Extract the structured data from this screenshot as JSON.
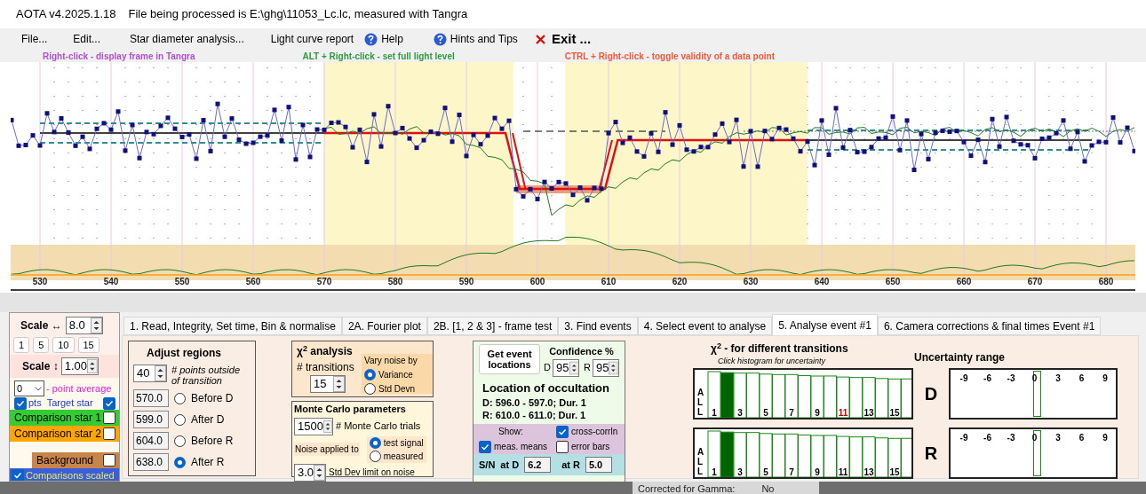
{
  "window": {
    "title": "AOTA v4.2025.1.18",
    "subtitle": "File being processed is E:\\ghg\\11053_Lc.lc, measured with Tangra"
  },
  "menu": [
    {
      "label": "File...",
      "kind": "plain"
    },
    {
      "label": "Edit...",
      "kind": "plain"
    },
    {
      "label": "Star diameter analysis...",
      "kind": "plain"
    },
    {
      "label": "Light curve report",
      "kind": "plain"
    },
    {
      "label": "Help",
      "kind": "help"
    },
    {
      "label": "Hints and Tips",
      "kind": "help"
    },
    {
      "label": "Exit ...",
      "kind": "exit"
    }
  ],
  "hints": [
    {
      "text": "Right-click  -  display frame in Tangra",
      "color": "#b04fd0"
    },
    {
      "text": "ALT + Right-click  -  set full light level",
      "color": "#2e9a3e"
    },
    {
      "text": "CTRL + Right-click  -  toggle validity of a data point",
      "color": "#f05a3c"
    }
  ],
  "light_curve": {
    "x_labels": [
      "530",
      "540",
      "550",
      "560",
      "570",
      "580",
      "590",
      "600",
      "610",
      "620",
      "630",
      "640",
      "650",
      "660",
      "670",
      "680"
    ]
  },
  "scale_panel": {
    "horizontal": {
      "label": "Scale ↔",
      "value": "8.0"
    },
    "presets": [
      "1",
      "5",
      "10",
      "15"
    ],
    "vertical": {
      "label": "Scale ↕",
      "value": "1.00"
    }
  },
  "display_panel": {
    "average": {
      "value": "0",
      "label": "- point average"
    },
    "plot_points": {
      "label": "pts",
      "checked": true
    },
    "series": [
      {
        "label": "Target star",
        "checked": true,
        "color": "#fff8ec"
      },
      {
        "label": "Comparison star 1",
        "checked": false,
        "color": "#33cc33"
      },
      {
        "label": "Comparison star 2",
        "checked": false,
        "color": "#ffa500"
      },
      {
        "label": "Background",
        "checked": false,
        "color": "#c8854a"
      }
    ],
    "scaled": {
      "label": "Comparisons scaled",
      "checked": true
    }
  },
  "tabs": [
    {
      "label": "1.  Read, Integrity, Set time, Bin & normalise",
      "selected": false
    },
    {
      "label": "2A. Fourier plot",
      "selected": false
    },
    {
      "label": "2B. [1, 2 & 3] - frame test",
      "selected": false
    },
    {
      "label": "3. Find events",
      "selected": false
    },
    {
      "label": "4. Select event to analyse",
      "selected": false
    },
    {
      "label": "5. Analyse event #1",
      "selected": true
    },
    {
      "label": "6. Camera corrections & final times Event #1",
      "selected": false
    }
  ],
  "adjust_regions": {
    "title": "Adjust regions",
    "points": {
      "value": "40",
      "label": "# points outside of transition"
    },
    "regions": [
      {
        "value": "570.0",
        "label": "Before D",
        "selected": false
      },
      {
        "value": "599.0",
        "label": "After D",
        "selected": false
      },
      {
        "value": "604.0",
        "label": "Before R",
        "selected": false
      },
      {
        "value": "638.0",
        "label": "After R",
        "selected": true
      }
    ]
  },
  "chi2_analysis": {
    "title": "χ$^{2}$ analysis",
    "transitions_label": "# transitions",
    "transitions": "15",
    "vary_title": "Vary noise by",
    "vary_options": [
      {
        "label": "Variance",
        "selected": true
      },
      {
        "label": "Std Devn",
        "selected": false
      }
    ]
  },
  "monte_carlo": {
    "title": "Monte Carlo parameters",
    "trials": {
      "value": "1500",
      "label": "# Monte Carlo trials"
    },
    "noise_label": "Noise applied to",
    "noise_options": [
      {
        "label": "test signal",
        "selected": true
      },
      {
        "label": "measured",
        "selected": false
      }
    ],
    "limit": {
      "value": "3.0",
      "label": "Std Dev limit on noise"
    }
  },
  "event": {
    "button": "Get event locations",
    "confidence_title": "Confidence %",
    "d": {
      "label": "D",
      "value": "95"
    },
    "r": {
      "label": "R",
      "value": "95"
    },
    "location_title": "Location of occultation",
    "locations": [
      "D: 596.0 - 597.0; Dur. 1",
      "R: 610.0 - 611.0; Dur. 1"
    ],
    "show_label": "Show:",
    "show_options": [
      {
        "label": "cross-corrln",
        "checked": true
      },
      {
        "label": "meas. means",
        "checked": true
      },
      {
        "label": "error bars",
        "checked": false
      }
    ],
    "sn": {
      "label": "S/N",
      "d_label": "at D",
      "d_value": "6.2",
      "r_label": "at R",
      "r_value": "5.0"
    }
  },
  "histograms": {
    "title": "χ$^{2}$ - for different transitions",
    "subtitle": "Click histogram for uncertainty",
    "rows": [
      {
        "side": "D",
        "all_label": "ALL",
        "bars": [
          {
            "selected": false
          },
          {
            "selected": true
          },
          {
            "selected": false
          },
          {
            "selected": false
          },
          {
            "selected": false
          },
          {
            "selected": false
          },
          {
            "selected": false
          },
          {
            "selected": false
          },
          {
            "selected": false
          },
          {
            "selected": false
          },
          {
            "selected": false
          },
          {
            "selected": false
          },
          {
            "selected": false
          },
          {
            "selected": false
          },
          {
            "selected": false
          },
          {
            "selected": false
          }
        ],
        "labels": [
          {
            "text": "1",
            "color": "#000000"
          },
          {
            "text": "3",
            "color": "#000000"
          },
          {
            "text": "5",
            "color": "#000000"
          },
          {
            "text": "7",
            "color": "#000000"
          },
          {
            "text": "9",
            "color": "#000000"
          },
          {
            "text": "11",
            "color": "#c00000"
          },
          {
            "text": "13",
            "color": "#000000"
          },
          {
            "text": "15",
            "color": "#000000"
          }
        ]
      },
      {
        "side": "R",
        "all_label": "ALL",
        "bars": [
          {
            "selected": false
          },
          {
            "selected": true
          },
          {
            "selected": false
          },
          {
            "selected": false
          },
          {
            "selected": false
          },
          {
            "selected": false
          },
          {
            "selected": false
          },
          {
            "selected": false
          },
          {
            "selected": false
          },
          {
            "selected": false
          },
          {
            "selected": false
          },
          {
            "selected": false
          },
          {
            "selected": false
          },
          {
            "selected": false
          },
          {
            "selected": false
          },
          {
            "selected": false
          }
        ],
        "labels": [
          {
            "text": "1",
            "color": "#000000"
          },
          {
            "text": "3",
            "color": "#000000"
          },
          {
            "text": "5",
            "color": "#000000"
          },
          {
            "text": "7",
            "color": "#000000"
          },
          {
            "text": "9",
            "color": "#000000"
          },
          {
            "text": "11",
            "color": "#000000"
          },
          {
            "text": "13",
            "color": "#000000"
          },
          {
            "text": "15",
            "color": "#000000"
          }
        ]
      }
    ]
  },
  "uncertainty": {
    "title": "Uncertainty range",
    "rows": [
      {
        "ticks": [
          "-9",
          "-6",
          "-3",
          "0",
          "3",
          "6",
          "9"
        ]
      },
      {
        "ticks": [
          "-9",
          "-6",
          "-3",
          "0",
          "3",
          "6",
          "9"
        ]
      }
    ]
  },
  "status": {
    "label": "Corrected for Gamma:",
    "value": "No"
  }
}
